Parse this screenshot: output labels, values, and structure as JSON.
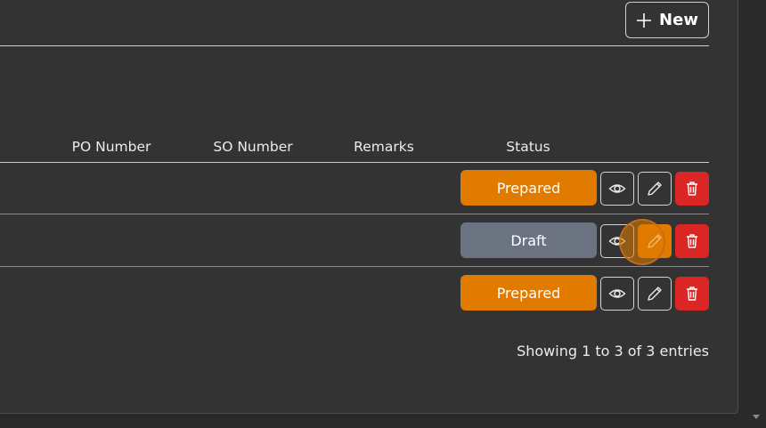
{
  "toolbar": {
    "new_label": "New"
  },
  "table": {
    "headers": {
      "po_number": "PO Number",
      "so_number": "SO Number",
      "remarks": "Remarks",
      "status": "Status"
    },
    "rows": [
      {
        "status": "Prepared",
        "status_color": "#e07b00"
      },
      {
        "status": "Draft",
        "status_color": "#6b7280"
      },
      {
        "status": "Prepared",
        "status_color": "#e07b00"
      }
    ]
  },
  "footer": {
    "info": "Showing 1 to 3 of 3 entries"
  },
  "colors": {
    "background": "#2a2a2a",
    "panel": "#333333",
    "prepared": "#e07b00",
    "draft": "#6b7280",
    "delete": "#dc2626",
    "edit_active": "#e07b00"
  },
  "icons": {
    "new": "plus-icon",
    "view": "eye-icon",
    "edit": "pencil-icon",
    "delete": "trash-icon"
  }
}
